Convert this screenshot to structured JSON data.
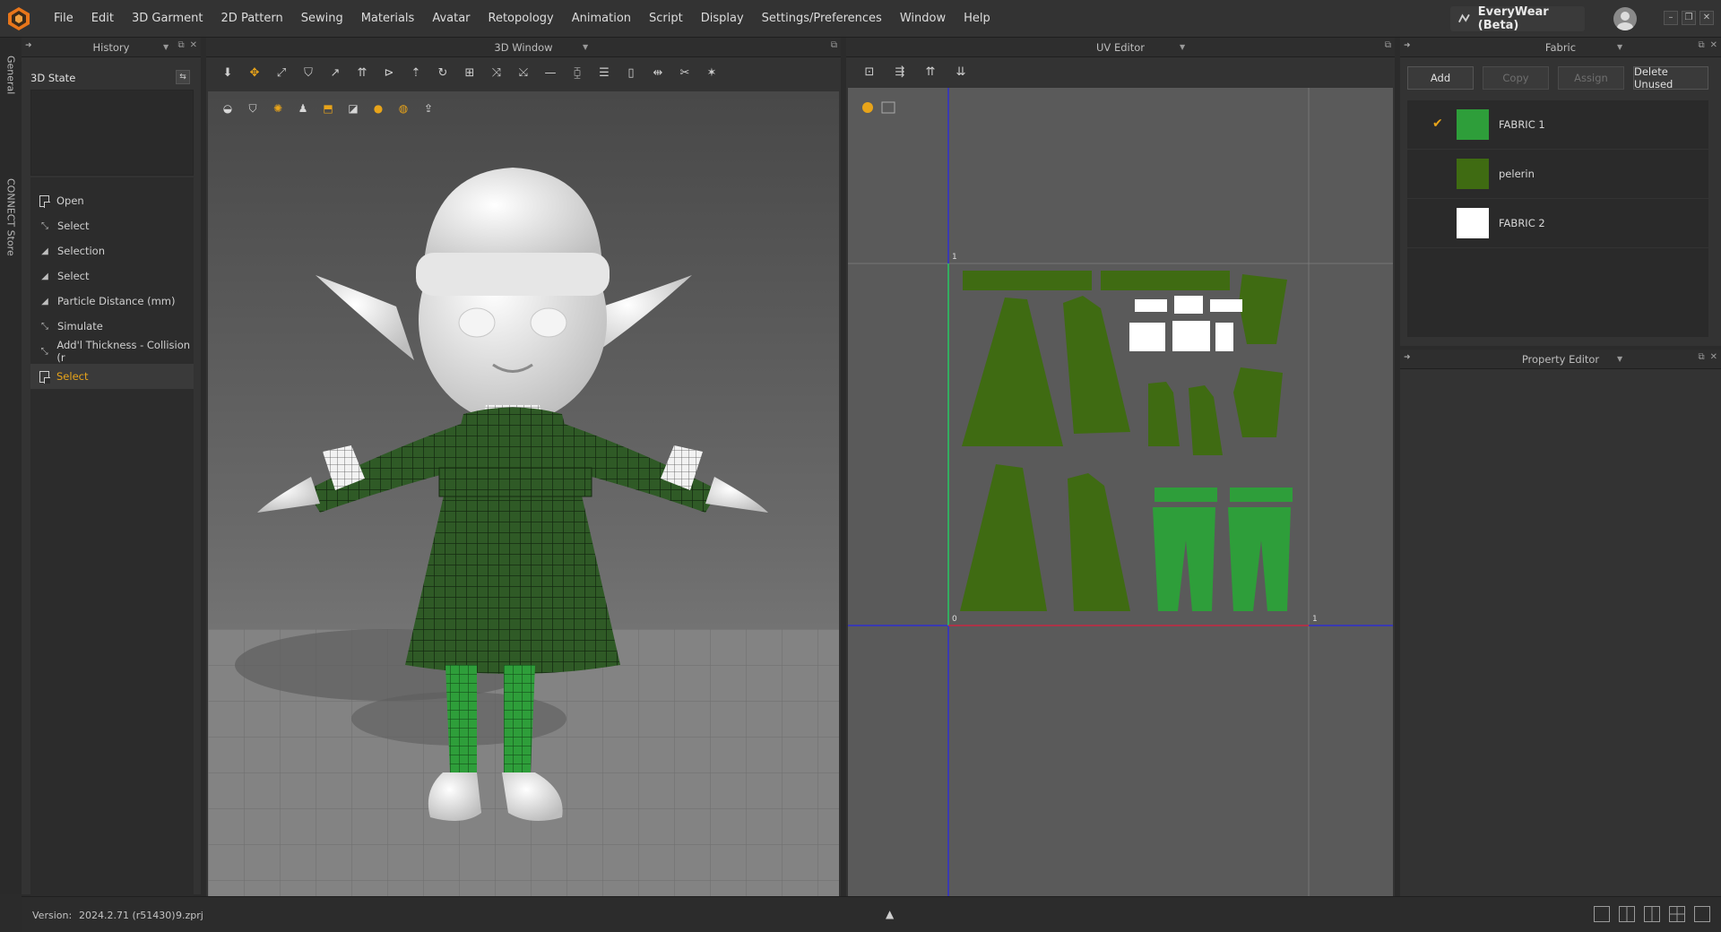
{
  "menu": [
    "File",
    "Edit",
    "3D Garment",
    "2D Pattern",
    "Sewing",
    "Materials",
    "Avatar",
    "Retopology",
    "Animation",
    "Script",
    "Display",
    "Settings/Preferences",
    "Window",
    "Help"
  ],
  "brand": "EveryWear (Beta)",
  "vtabs": {
    "general": "General",
    "connect": "CONNECT Store"
  },
  "history": {
    "title": "History",
    "state_label": "3D State",
    "items": [
      {
        "label": "Open",
        "icon": "doc-icon"
      },
      {
        "label": "Select",
        "icon": "cursor-icon"
      },
      {
        "label": "Selection",
        "icon": "triangle-icon"
      },
      {
        "label": "Select",
        "icon": "triangle-icon"
      },
      {
        "label": "Particle Distance (mm)",
        "icon": "triangle-icon"
      },
      {
        "label": "Simulate",
        "icon": "cursor-icon"
      },
      {
        "label": "Add'l Thickness - Collision (r",
        "icon": "cursor-icon"
      },
      {
        "label": "Select",
        "icon": "doc-icon",
        "active": true
      }
    ]
  },
  "view3d": {
    "title": "3D Window"
  },
  "uv": {
    "title": "UV Editor",
    "axis_one_top": "1",
    "axis_zero": "0",
    "axis_one_right": "1"
  },
  "fabric": {
    "title": "Fabric",
    "buttons": {
      "add": "Add",
      "copy": "Copy",
      "assign": "Assign",
      "delete_unused": "Delete Unused"
    },
    "items": [
      {
        "name": "FABRIC 1",
        "color": "#2e9e3a",
        "checked": true
      },
      {
        "name": "pelerin",
        "color": "#3f6b12",
        "checked": false
      },
      {
        "name": "FABRIC 2",
        "color": "#ffffff",
        "checked": false
      }
    ]
  },
  "property": {
    "title": "Property Editor"
  },
  "status": {
    "version_label": "Version:",
    "version": "2024.2.71 (r51430)",
    "file": "9.zprj"
  },
  "colors": {
    "accent": "#e8a41a",
    "dark_green": "#3f6b12",
    "bright_green": "#2e9e3a"
  }
}
